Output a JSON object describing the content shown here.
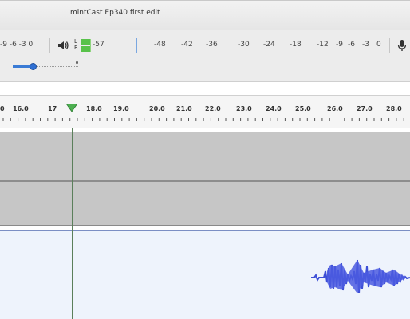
{
  "window": {
    "title": "mintCast Ep340 first edit"
  },
  "toolbar": {
    "playback_meter_scale_tail": "-9 -6 -3 0",
    "speaker_icon": "speaker-icon",
    "meter_lr": "L\nR",
    "recording_meter_value": "-57",
    "recording_meter_scale": [
      "-48",
      "-42",
      "-36",
      "-30",
      "-24",
      "-18",
      "-12",
      "-9",
      "-6",
      "-3",
      "0"
    ],
    "mic_icon": "microphone-icon"
  },
  "ruler": {
    "labels": [
      "16.0",
      "17.0",
      "18.0",
      "19.0",
      "20.0",
      "21.0",
      "22.0",
      "23.0",
      "24.0",
      "25.0",
      "26.0",
      "27.0",
      "28.0"
    ],
    "partial_left": "0",
    "pin_label": "17"
  },
  "colors": {
    "meter_green": "#58c24a",
    "waveform_blue": "#3d4fd6",
    "playhead_green": "#5b7f5b"
  }
}
